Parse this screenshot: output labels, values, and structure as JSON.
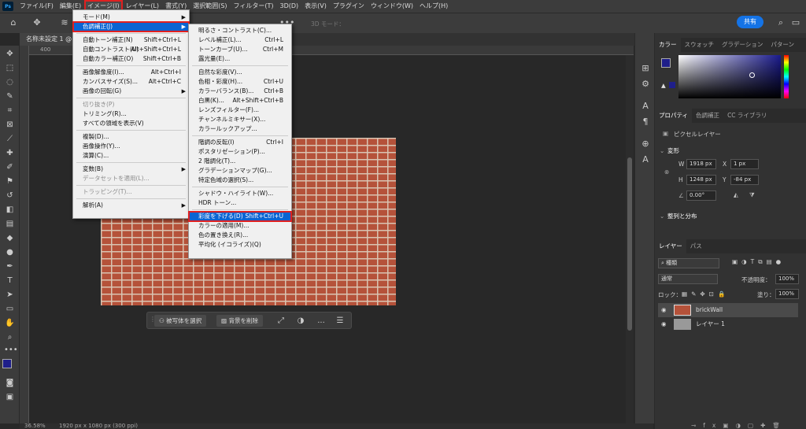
{
  "app": {
    "logo": "Ps"
  },
  "menubar": {
    "items": [
      "ファイル(F)",
      "編集(E)",
      "イメージ(I)",
      "レイヤー(L)",
      "書式(Y)",
      "選択範囲(S)",
      "フィルター(T)",
      "3D(D)",
      "表示(V)",
      "プラグイン",
      "ウィンドウ(W)",
      "ヘルプ(H)"
    ]
  },
  "optionsbar": {
    "mode3d": "3D モード：",
    "share": "共有"
  },
  "document": {
    "tab": "名称未設定 1 @",
    "ruler_left": "400",
    "zoom": "36.58%",
    "size": "1920 px x 1080 px (300 ppi)"
  },
  "image_menu": {
    "items": [
      {
        "label": "モード(M)",
        "shortcut": "",
        "submenu": true
      },
      {
        "label": "色調補正(J)",
        "shortcut": "",
        "submenu": true,
        "highlight": true
      },
      {
        "label": "自動トーン補正(N)",
        "shortcut": "Shift+Ctrl+L"
      },
      {
        "label": "自動コントラスト(U)",
        "shortcut": "Alt+Shift+Ctrl+L"
      },
      {
        "label": "自動カラー補正(O)",
        "shortcut": "Shift+Ctrl+B"
      },
      {
        "label": "画像解像度(I)...",
        "shortcut": "Alt+Ctrl+I"
      },
      {
        "label": "カンバスサイズ(S)...",
        "shortcut": "Alt+Ctrl+C"
      },
      {
        "label": "画像の回転(G)",
        "shortcut": "",
        "submenu": true
      },
      {
        "label": "切り抜き(P)",
        "shortcut": "",
        "disabled": true
      },
      {
        "label": "トリミング(R)...",
        "shortcut": ""
      },
      {
        "label": "すべての領域を表示(V)",
        "shortcut": ""
      },
      {
        "label": "複製(D)...",
        "shortcut": ""
      },
      {
        "label": "画像操作(Y)...",
        "shortcut": ""
      },
      {
        "label": "演算(C)...",
        "shortcut": ""
      },
      {
        "label": "変数(B)",
        "shortcut": "",
        "submenu": true
      },
      {
        "label": "データセットを適用(L)...",
        "shortcut": "",
        "disabled": true
      },
      {
        "label": "トラッピング(T)...",
        "shortcut": "",
        "disabled": true
      },
      {
        "label": "解析(A)",
        "shortcut": "",
        "submenu": true
      }
    ]
  },
  "adjust_menu": {
    "items": [
      {
        "label": "明るさ・コントラスト(C)...",
        "shortcut": ""
      },
      {
        "label": "レベル補正(L)...",
        "shortcut": "Ctrl+L"
      },
      {
        "label": "トーンカーブ(U)...",
        "shortcut": "Ctrl+M"
      },
      {
        "label": "露光量(E)...",
        "shortcut": ""
      },
      {
        "label": "自然な彩度(V)...",
        "shortcut": ""
      },
      {
        "label": "色相・彩度(H)...",
        "shortcut": "Ctrl+U"
      },
      {
        "label": "カラーバランス(B)...",
        "shortcut": "Ctrl+B"
      },
      {
        "label": "白黒(K)...",
        "shortcut": "Alt+Shift+Ctrl+B"
      },
      {
        "label": "レンズフィルター(F)...",
        "shortcut": ""
      },
      {
        "label": "チャンネルミキサー(X)...",
        "shortcut": ""
      },
      {
        "label": "カラールックアップ...",
        "shortcut": ""
      },
      {
        "label": "階調の反転(I)",
        "shortcut": "Ctrl+I"
      },
      {
        "label": "ポスタリゼーション(P)...",
        "shortcut": ""
      },
      {
        "label": "2 階調化(T)...",
        "shortcut": ""
      },
      {
        "label": "グラデーションマップ(G)...",
        "shortcut": ""
      },
      {
        "label": "特定色域の選択(S)...",
        "shortcut": ""
      },
      {
        "label": "シャドウ・ハイライト(W)...",
        "shortcut": ""
      },
      {
        "label": "HDR トーン...",
        "shortcut": ""
      },
      {
        "label": "彩度を下げる(D)",
        "shortcut": "Shift+Ctrl+U",
        "highlight": true
      },
      {
        "label": "カラーの適用(M)...",
        "shortcut": ""
      },
      {
        "label": "色の置き換え(R)...",
        "shortcut": ""
      },
      {
        "label": "平均化 (イコライズ)(Q)",
        "shortcut": ""
      }
    ]
  },
  "contextbar": {
    "select_subject": "被写体を選択",
    "remove_bg": "背景を削除",
    "more": "..."
  },
  "panels": {
    "color_tabs": [
      "カラー",
      "スウォッチ",
      "グラデーション",
      "パターン"
    ],
    "props_tabs": [
      "プロパティ",
      "色調補正",
      "CC ライブラリ"
    ],
    "pixel_layer": "ピクセルレイヤー",
    "transform": "変形",
    "w_label": "W",
    "w": "1918 px",
    "x_label": "X",
    "x": "1 px",
    "h_label": "H",
    "h": "1248 px",
    "y_label": "Y",
    "y": "-84 px",
    "angle": "0.00°",
    "align": "整列と分布",
    "layer_tabs": [
      "レイヤー",
      "パス"
    ],
    "kind": "種類",
    "blend": "通常",
    "opacity_label": "不透明度：",
    "opacity": "100%",
    "lock_label": "ロック：",
    "fill_label": "塗り：",
    "fill": "100%",
    "layers": [
      {
        "name": "brickWall",
        "selected": true
      },
      {
        "name": "レイヤー 1",
        "selected": false
      }
    ]
  },
  "colors": {
    "fg": "#1f1f8a",
    "accent": "#1473e6",
    "highlight_border": "#e02020"
  }
}
